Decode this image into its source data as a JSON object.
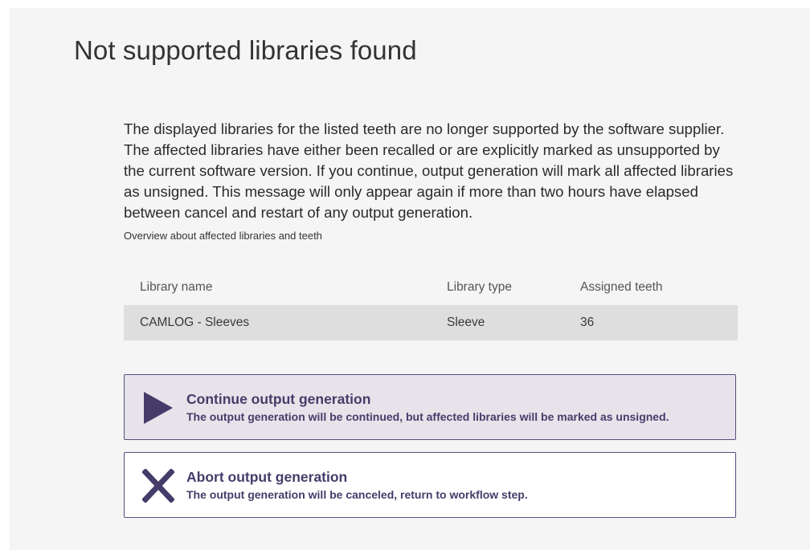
{
  "dialog": {
    "title": "Not supported libraries found",
    "message": "The displayed libraries for the listed teeth are no longer supported by the software supplier. The affected libraries have either been recalled or are explicitly marked as unsupported by the current software version. If you continue, output generation will mark all affected libraries as unsigned. This message will only appear again if more than two hours have elapsed between cancel and restart of any output generation.",
    "overview_label": "Overview about affected libraries and teeth"
  },
  "table": {
    "headers": [
      "Library name",
      "Library type",
      "Assigned teeth"
    ],
    "rows": [
      [
        "CAMLOG - Sleeves",
        "Sleeve",
        "36"
      ]
    ]
  },
  "options": {
    "continue": {
      "title": "Continue output generation",
      "description": "The output generation will be continued, but affected libraries will be marked as unsigned.",
      "icon": "play-icon"
    },
    "abort": {
      "title": "Abort output generation",
      "description": "The output generation will be canceled, return to workflow step.",
      "icon": "close-icon"
    }
  },
  "colors": {
    "accent": "#463c6a",
    "border": "#5a4d7e",
    "selected_bg": "#e6e3ea",
    "table_row_bg": "#dedede",
    "panel_bg": "#f5f5f5"
  }
}
